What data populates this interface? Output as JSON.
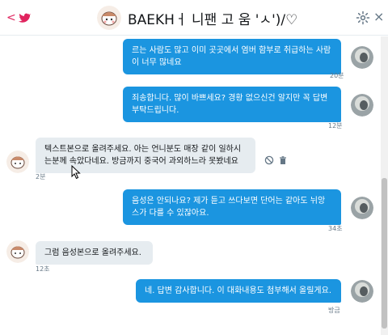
{
  "header": {
    "title": "BAEKHㅓ 니팬 고 움 'ㅅ')/♡",
    "back_glyph": "<",
    "close_glyph": "×",
    "icons": [
      "back-arrow-icon",
      "twitter-bird-icon",
      "gear-icon",
      "close-icon"
    ],
    "accent_color": "#e0245e"
  },
  "messages": [
    {
      "direction": "out",
      "lines": [
        "르는 사람도 많고 이미 곳곳에서 염버 함부로 취급하는 사람",
        "이 너무 많네요"
      ],
      "time": "20분"
    },
    {
      "direction": "out",
      "lines": [
        "죄송합니다. 많이 바쁘세요? 경황 없으신건 알지만 꼭 답변",
        "부탁드립니다."
      ],
      "time": "12분"
    },
    {
      "direction": "in",
      "lines": [
        "텍스트본으로 올려주세요. 아는 언니분도 매장 같이 일하시",
        "는분께 속았다네요. 방금까지 중국어 과외하느라 못봤네요"
      ],
      "time": "2분"
    },
    {
      "direction": "out",
      "lines": [
        "음성은 안되나요? 제가 듣고 쓰다보면 단어는 같아도 뉘앙",
        "스가 다를 수 있잖아요."
      ],
      "time": "34초"
    },
    {
      "direction": "in",
      "lines": [
        "그럼 음성본으로 올려주세요."
      ],
      "time": "12초"
    },
    {
      "direction": "out",
      "lines": [
        "네. 답변 감사합니다. 이 대화내용도 첨부해서 올릴게요."
      ],
      "time": "방금"
    }
  ],
  "message_actions": [
    "report-icon",
    "delete-icon"
  ],
  "colors": {
    "outgoing_bubble": "#1b95e0",
    "incoming_bubble": "#e6ecf0"
  }
}
